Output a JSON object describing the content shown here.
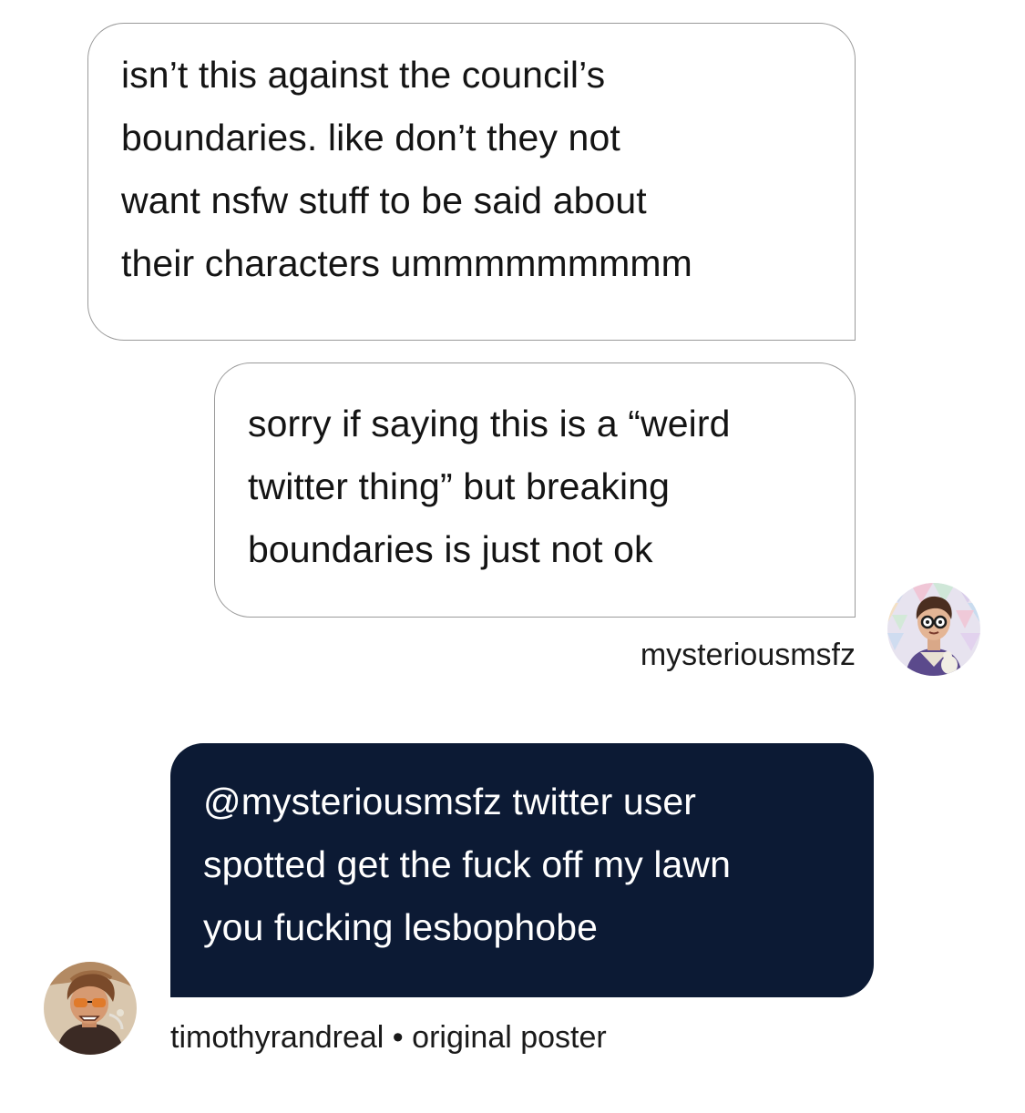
{
  "messages": [
    {
      "lines": [
        "isn’t this against the council’s",
        "boundaries. like don’t they not",
        "want nsfw stuff to be said about",
        "their characters ummmmmmmmm"
      ]
    },
    {
      "lines": [
        "sorry if saying this is a “weird",
        "twitter thing” but breaking",
        "boundaries is just not ok"
      ],
      "username": "mysteriousmsfz"
    },
    {
      "lines": [
        "@mysteriousmsfz twitter user",
        "spotted get the fuck off my lawn",
        "you fucking lesbophobe"
      ],
      "username": "timothyrandreal",
      "separator": "•",
      "role": "original poster"
    }
  ],
  "colors": {
    "dark_bubble": "#0c1a34",
    "light_bubble_border": "#9a9a9a",
    "text": "#141414"
  },
  "icons": {
    "avatar_1": "avatar-cartoon-person-glasses",
    "avatar_2": "avatar-cartoon-person-sunglasses"
  }
}
